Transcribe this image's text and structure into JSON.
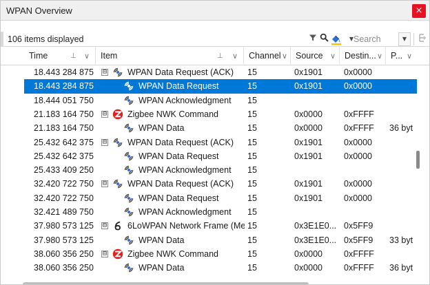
{
  "window": {
    "title": "WPAN Overview",
    "close_glyph": "×"
  },
  "toolbar": {
    "count_label": "106 items displayed",
    "search_placeholder": "Search",
    "icons": [
      "filter-icon",
      "magnify-icon",
      "highlight-icon",
      "expand-icon"
    ]
  },
  "columns": [
    {
      "label": "Time",
      "sort_glyph": "⊥",
      "dd_glyph": "∨"
    },
    {
      "label": "Item",
      "sort_glyph": "⊥",
      "dd_glyph": "∨"
    },
    {
      "label": "Channel",
      "dd_glyph": "∨"
    },
    {
      "label": "Source",
      "dd_glyph": "∨"
    },
    {
      "label": "Destin...",
      "dd_glyph": "∨"
    },
    {
      "label": "P...",
      "dd_glyph": "∨"
    }
  ],
  "colors": {
    "selection": "#0078d7",
    "zigbee_red": "#e02020",
    "close_red": "#e81123"
  },
  "rows": [
    {
      "time": "18.443 284 875",
      "item": "WPAN Data Request (ACK)",
      "channel": "15",
      "source": "0x1901",
      "dest": "0x0000",
      "p": "",
      "level": 0,
      "icon": "wpan-icon",
      "expander": "⊟"
    },
    {
      "time": "18.443 284 875",
      "item": "WPAN Data Request",
      "channel": "15",
      "source": "0x1901",
      "dest": "0x0000",
      "p": "",
      "level": 1,
      "icon": "wpan-icon",
      "selected": true
    },
    {
      "time": "18.444 051 750",
      "item": "WPAN Acknowledgment",
      "channel": "15",
      "source": "",
      "dest": "",
      "p": "",
      "level": 1,
      "icon": "wpan-icon"
    },
    {
      "time": "21.183 164 750",
      "item": "Zigbee NWK Command",
      "channel": "15",
      "source": "0x0000",
      "dest": "0xFFFF",
      "p": "",
      "level": 0,
      "icon": "zigbee-icon",
      "expander": "⊟"
    },
    {
      "time": "21.183 164 750",
      "item": "WPAN Data",
      "channel": "15",
      "source": "0x0000",
      "dest": "0xFFFF",
      "p": "36 byt",
      "level": 1,
      "icon": "wpan-icon"
    },
    {
      "time": "25.432 642 375",
      "item": "WPAN Data Request (ACK)",
      "channel": "15",
      "source": "0x1901",
      "dest": "0x0000",
      "p": "",
      "level": 0,
      "icon": "wpan-icon",
      "expander": "⊟"
    },
    {
      "time": "25.432 642 375",
      "item": "WPAN Data Request",
      "channel": "15",
      "source": "0x1901",
      "dest": "0x0000",
      "p": "",
      "level": 1,
      "icon": "wpan-icon"
    },
    {
      "time": "25.433 409 250",
      "item": "WPAN Acknowledgment",
      "channel": "15",
      "source": "",
      "dest": "",
      "p": "",
      "level": 1,
      "icon": "wpan-icon"
    },
    {
      "time": "32.420 722 750",
      "item": "WPAN Data Request (ACK)",
      "channel": "15",
      "source": "0x1901",
      "dest": "0x0000",
      "p": "",
      "level": 0,
      "icon": "wpan-icon",
      "expander": "⊟"
    },
    {
      "time": "32.420 722 750",
      "item": "WPAN Data Request",
      "channel": "15",
      "source": "0x1901",
      "dest": "0x0000",
      "p": "",
      "level": 1,
      "icon": "wpan-icon"
    },
    {
      "time": "32.421 489 750",
      "item": "WPAN Acknowledgment",
      "channel": "15",
      "source": "",
      "dest": "",
      "p": "",
      "level": 1,
      "icon": "wpan-icon"
    },
    {
      "time": "37.980 573 125",
      "item": "6LoWPAN Network Frame (Me...",
      "channel": "15",
      "source": "0x3E1E0...",
      "dest": "0x5FF9",
      "p": "",
      "level": 0,
      "icon": "sixlowpan-icon",
      "expander": "⊟"
    },
    {
      "time": "37.980 573 125",
      "item": "WPAN Data",
      "channel": "15",
      "source": "0x3E1E0...",
      "dest": "0x5FF9",
      "p": "33 byt",
      "level": 1,
      "icon": "wpan-icon"
    },
    {
      "time": "38.060 356 250",
      "item": "Zigbee NWK Command",
      "channel": "15",
      "source": "0x0000",
      "dest": "0xFFFF",
      "p": "",
      "level": 0,
      "icon": "zigbee-icon",
      "expander": "⊟"
    },
    {
      "time": "38.060 356 250",
      "item": "WPAN Data",
      "channel": "15",
      "source": "0x0000",
      "dest": "0xFFFF",
      "p": "36 byt",
      "level": 1,
      "icon": "wpan-icon"
    }
  ]
}
